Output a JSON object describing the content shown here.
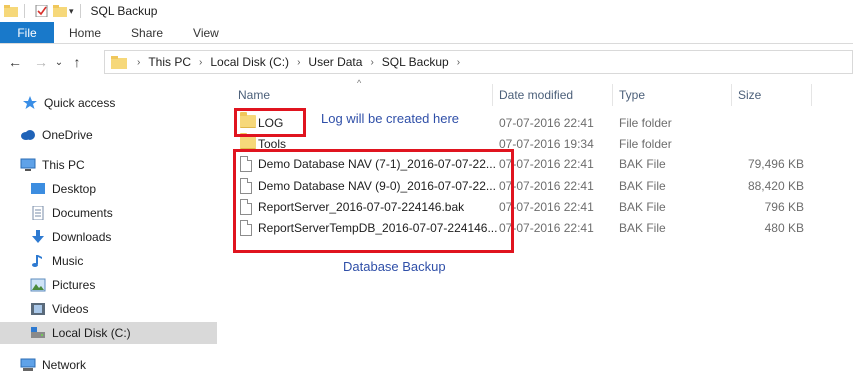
{
  "window": {
    "title": "SQL Backup",
    "qa_dropdown": "▾"
  },
  "ribbon": {
    "file_tab": "File",
    "tabs": [
      "Home",
      "Share",
      "View"
    ]
  },
  "nav": {
    "back": "←",
    "forward": "→",
    "recent": "⌄",
    "up": "↑"
  },
  "breadcrumb": [
    "This PC",
    "Local Disk (C:)",
    "User Data",
    "SQL Backup"
  ],
  "breadcrumb_sep": "›",
  "sidebar": {
    "items": [
      {
        "label": "Quick access",
        "icon": "star-icon"
      },
      {
        "label": "OneDrive",
        "icon": "cloud-icon"
      },
      {
        "label": "This PC",
        "icon": "computer-icon"
      },
      {
        "label": "Desktop",
        "icon": "desktop-icon"
      },
      {
        "label": "Documents",
        "icon": "documents-icon"
      },
      {
        "label": "Downloads",
        "icon": "download-icon"
      },
      {
        "label": "Music",
        "icon": "music-icon"
      },
      {
        "label": "Pictures",
        "icon": "pictures-icon"
      },
      {
        "label": "Videos",
        "icon": "videos-icon"
      },
      {
        "label": "Local Disk (C:)",
        "icon": "drive-icon",
        "selected": true
      },
      {
        "label": "Network",
        "icon": "network-icon"
      }
    ]
  },
  "columns": {
    "name": "Name",
    "date": "Date modified",
    "type": "Type",
    "size": "Size"
  },
  "files": [
    {
      "name": "LOG",
      "date": "07-07-2016 22:41",
      "type": "File folder",
      "size": "",
      "kind": "folder"
    },
    {
      "name": "Tools",
      "date": "07-07-2016 19:34",
      "type": "File folder",
      "size": "",
      "kind": "folder"
    },
    {
      "name": "Demo Database NAV (7-1)_2016-07-07-22...",
      "date": "07-07-2016 22:41",
      "type": "BAK File",
      "size": "79,496 KB",
      "kind": "file"
    },
    {
      "name": "Demo Database NAV (9-0)_2016-07-07-22...",
      "date": "07-07-2016 22:41",
      "type": "BAK File",
      "size": "88,420 KB",
      "kind": "file"
    },
    {
      "name": "ReportServer_2016-07-07-224146.bak",
      "date": "07-07-2016 22:41",
      "type": "BAK File",
      "size": "796 KB",
      "kind": "file"
    },
    {
      "name": "ReportServerTempDB_2016-07-07-224146...",
      "date": "07-07-2016 22:41",
      "type": "BAK File",
      "size": "480 KB",
      "kind": "file"
    }
  ],
  "annotations": {
    "log_note": "Log will be created here",
    "backup_note": "Database Backup",
    "color": "#e0141f",
    "text_color": "#2f4fa8"
  },
  "colors": {
    "file_tab": "#1979ca",
    "selected_nav": "#d9d9d9"
  }
}
